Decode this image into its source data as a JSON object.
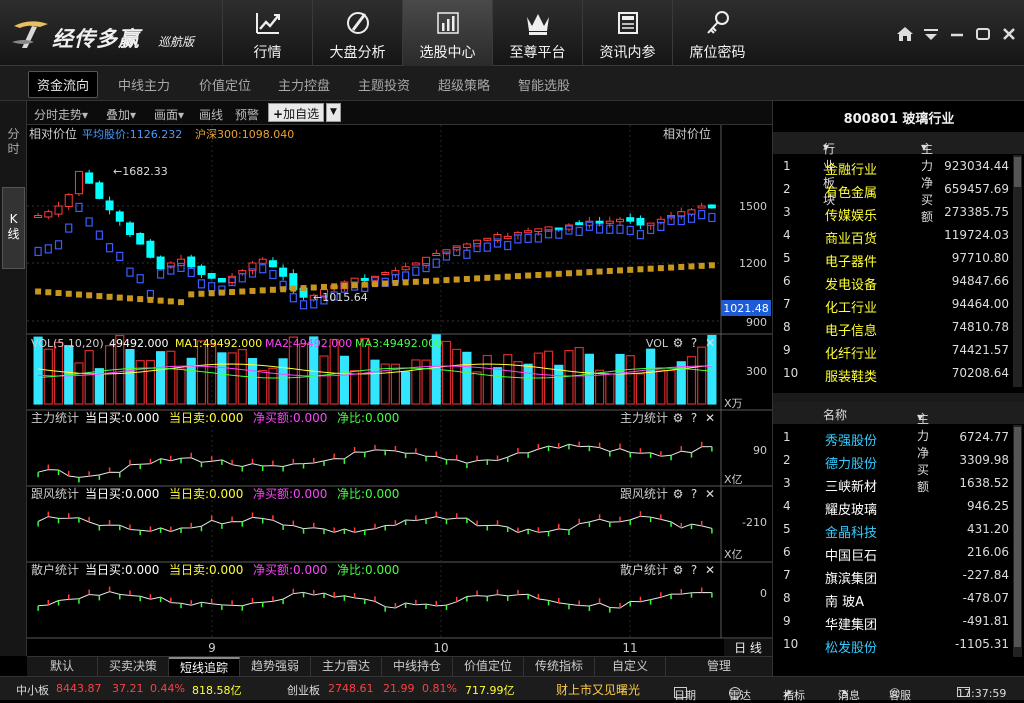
{
  "app": {
    "name": "经传多赢",
    "edition": "巡航版"
  },
  "nav": [
    {
      "label": "行情",
      "icon": "trend-chart-icon"
    },
    {
      "label": "大盘分析",
      "icon": "compass-icon"
    },
    {
      "label": "选股中心",
      "icon": "bar-chart-icon",
      "active": true
    },
    {
      "label": "至尊平台",
      "icon": "crown-icon"
    },
    {
      "label": "资讯内参",
      "icon": "document-icon"
    },
    {
      "label": "席位密码",
      "icon": "key-icon"
    }
  ],
  "subnav": [
    "资金流向",
    "中线主力",
    "价值定位",
    "主力控盘",
    "主题投资",
    "超级策略",
    "智能选股"
  ],
  "vtabs": {
    "intraday": "分\n时",
    "kline": "K\n线"
  },
  "toolbar": {
    "fenshi": "分时走势",
    "diejia": "叠加",
    "huamian": "画面",
    "huaxian": "画线",
    "yujing": "预警",
    "add": "加自选"
  },
  "chart": {
    "main_left": "相对价位",
    "avg_label": "平均股价:1126.232",
    "hs300_label": "沪深300:1098.040",
    "main_right": "相对价位",
    "high_label": "1682.33",
    "low_label": "1015.64",
    "y_1500": "1500",
    "y_1200": "1200",
    "y_900": "900",
    "current_price": "1021.48",
    "vol_label": "VOL(5,10,20)",
    "vol_val": "49492.000",
    "ma1": "MA1:49492.000",
    "ma2": "MA2:49492.000",
    "ma3": "MA3:49492.000",
    "vol_right": "VOL",
    "vol_y": "300",
    "vol_unit": "X万",
    "panels": [
      {
        "title": "主力统计",
        "buy": "当日买:0.000",
        "sell": "当日卖:0.000",
        "net": "净买额:0.000",
        "ratio": "净比:0.000",
        "right": "主力统计",
        "y": "90",
        "unit": "X亿"
      },
      {
        "title": "跟风统计",
        "buy": "当日买:0.000",
        "sell": "当日卖:0.000",
        "net": "净买额:0.000",
        "ratio": "净比:0.000",
        "right": "跟风统计",
        "y": "-210",
        "unit": "X亿"
      },
      {
        "title": "散户统计",
        "buy": "当日买:0.000",
        "sell": "当日卖:0.000",
        "net": "净买额:0.000",
        "ratio": "净比:0.000",
        "right": "散户统计",
        "y": "0",
        "unit": ""
      }
    ],
    "x_labels": [
      "9",
      "10",
      "11"
    ],
    "period": "日 线",
    "colors": {
      "up": "#ff3b3b",
      "down": "#00ffff",
      "avg": "#3c5cff",
      "hs300": "#c8961e",
      "vol_up": "#d62b2b",
      "vol_down": "#33e6ff"
    }
  },
  "bottom_tabs": [
    "默认",
    "买卖决策",
    "短线追踪",
    "趋势强弱",
    "主力雷达",
    "中线持仓",
    "价值定位",
    "传统指标",
    "自定义",
    "管理"
  ],
  "status": {
    "sme_label": "中小板",
    "sme_val": "8443.87",
    "sme_chg": "37.21",
    "sme_pct": "0.44%",
    "sme_amt": "818.58亿",
    "gem_label": "创业板",
    "gem_val": "2748.61",
    "gem_chg": "21.99",
    "gem_pct": "0.81%",
    "gem_amt": "717.99亿",
    "ticker": "财上市又见曙光",
    "calendar": "日期",
    "radar": "雷达",
    "indicator": "指标",
    "message": "消息",
    "service": "客服",
    "time": "17:37:59"
  },
  "industry_panel": {
    "title": "800801  玻璃行业",
    "col1": "行业板块",
    "col2": "主力净买额",
    "rows": [
      {
        "n": "1",
        "name": "金融行业",
        "val": "923034.44"
      },
      {
        "n": "2",
        "name": "有色金属",
        "val": "659457.69"
      },
      {
        "n": "3",
        "name": "传媒娱乐",
        "val": "273385.75"
      },
      {
        "n": "4",
        "name": "商业百货",
        "val": "119724.03"
      },
      {
        "n": "5",
        "name": "电子器件",
        "val": "97710.80"
      },
      {
        "n": "6",
        "name": "发电设备",
        "val": "94847.66"
      },
      {
        "n": "7",
        "name": "化工行业",
        "val": "94464.00"
      },
      {
        "n": "8",
        "name": "电子信息",
        "val": "74810.78"
      },
      {
        "n": "9",
        "name": "化纤行业",
        "val": "74421.57"
      },
      {
        "n": "10",
        "name": "服装鞋类",
        "val": "70208.64"
      }
    ]
  },
  "stock_panel": {
    "col1": "名称",
    "col2": "主力净买额",
    "rows": [
      {
        "n": "1",
        "name": "秀强股份",
        "val": "6724.77",
        "color": "#33ccff"
      },
      {
        "n": "2",
        "name": "德力股份",
        "val": "3309.98",
        "color": "#33ccff"
      },
      {
        "n": "3",
        "name": "三峡新材",
        "val": "1638.52",
        "color": "#ffffff"
      },
      {
        "n": "4",
        "name": "耀皮玻璃",
        "val": "946.25",
        "color": "#ffffff"
      },
      {
        "n": "5",
        "name": "金晶科技",
        "val": "431.20",
        "color": "#33ccff"
      },
      {
        "n": "6",
        "name": "中国巨石",
        "val": "216.06",
        "color": "#ffffff"
      },
      {
        "n": "7",
        "name": "旗滨集团",
        "val": "-227.84",
        "color": "#ffffff"
      },
      {
        "n": "8",
        "name": "南 玻A",
        "val": "-478.07",
        "color": "#ffffff"
      },
      {
        "n": "9",
        "name": "华建集团",
        "val": "-491.81",
        "color": "#ffffff"
      },
      {
        "n": "10",
        "name": "松发股份",
        "val": "-1105.31",
        "color": "#33ccff"
      }
    ]
  }
}
